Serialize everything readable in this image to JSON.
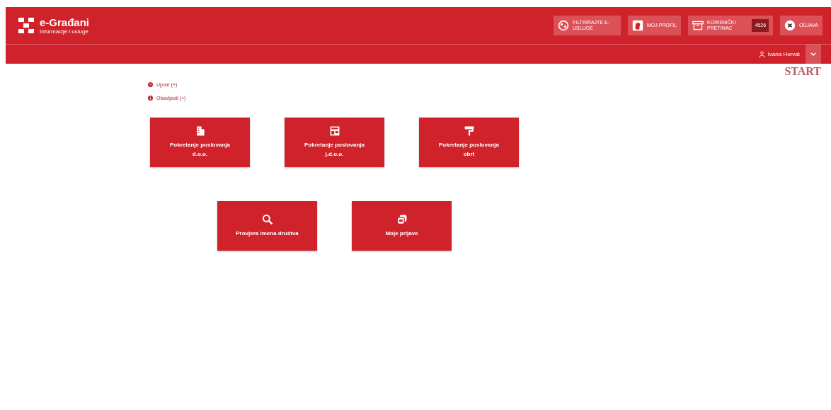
{
  "header": {
    "title": "e-Građani",
    "subtitle": "Informacije i usluge",
    "actions": [
      {
        "kind": "filter",
        "label": "FILTRIRAJTE E-USLUGE"
      },
      {
        "kind": "profile",
        "label": "MOJ PROFIL"
      },
      {
        "kind": "inbox",
        "label": "KORISNIČKI PRETINAC",
        "badge": "4526"
      },
      {
        "kind": "logout",
        "label": "ODJAVA"
      }
    ],
    "user": "Ivana Horvat"
  },
  "page_title": "START",
  "links": [
    {
      "kind": "help",
      "label": "Upute (+)"
    },
    {
      "kind": "info",
      "label": "Obavijesti (+)"
    }
  ],
  "tile_rows": [
    [
      {
        "kind": "building",
        "label": "Pokretanje poslovanja d.o.o."
      },
      {
        "kind": "shop",
        "label": "Pokretanje poslovanja j.d.o.o."
      },
      {
        "kind": "roller",
        "label": "Pokretanje poslovanja obrt"
      }
    ],
    [
      {
        "kind": "search",
        "label": "Provjera imena društva"
      },
      {
        "kind": "stack",
        "label": "Moje prijave"
      }
    ]
  ]
}
